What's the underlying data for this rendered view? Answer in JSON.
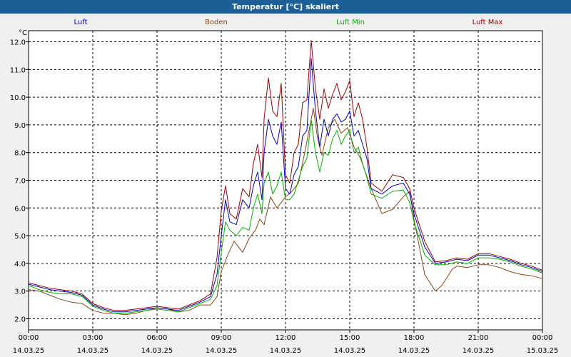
{
  "window": {
    "title": "Temperatur [°C] skaliert"
  },
  "chart_data": {
    "type": "line",
    "title": "Temperatur [°C] skaliert",
    "ylabel": "°C",
    "ylim": [
      1.6,
      12.4
    ],
    "yticks": [
      "2.0",
      "3.0",
      "4.0",
      "5.0",
      "6.0",
      "7.0",
      "8.0",
      "9.0",
      "10.0",
      "11.0",
      "12.0"
    ],
    "xlim": [
      0,
      24
    ],
    "xticks": [
      {
        "time": "00:00",
        "date": "14.03.25"
      },
      {
        "time": "03:00",
        "date": "14.03.25"
      },
      {
        "time": "06:00",
        "date": "14.03.25"
      },
      {
        "time": "09:00",
        "date": "14.03.25"
      },
      {
        "time": "12:00",
        "date": "14.03.25"
      },
      {
        "time": "15:00",
        "date": "14.03.25"
      },
      {
        "time": "18:00",
        "date": "14.03.25"
      },
      {
        "time": "21:00",
        "date": "14.03.25"
      },
      {
        "time": "00:00",
        "date": "15.03.25"
      }
    ],
    "grid": true,
    "legend_position": "top",
    "series": [
      {
        "name": "Luft",
        "color": "#0000c8",
        "points": [
          [
            0,
            3.25
          ],
          [
            0.5,
            3.15
          ],
          [
            1,
            3.05
          ],
          [
            1.5,
            3.0
          ],
          [
            2,
            2.95
          ],
          [
            2.5,
            2.85
          ],
          [
            3,
            2.5
          ],
          [
            3.5,
            2.35
          ],
          [
            4,
            2.25
          ],
          [
            4.5,
            2.25
          ],
          [
            5,
            2.3
          ],
          [
            5.5,
            2.35
          ],
          [
            6,
            2.4
          ],
          [
            6.5,
            2.35
          ],
          [
            7,
            2.3
          ],
          [
            7.5,
            2.45
          ],
          [
            8,
            2.6
          ],
          [
            8.5,
            2.8
          ],
          [
            8.8,
            3.6
          ],
          [
            9,
            5.0
          ],
          [
            9.2,
            6.3
          ],
          [
            9.4,
            5.5
          ],
          [
            9.7,
            5.4
          ],
          [
            10,
            6.3
          ],
          [
            10.3,
            6.0
          ],
          [
            10.5,
            6.8
          ],
          [
            10.7,
            7.3
          ],
          [
            10.9,
            6.3
          ],
          [
            11,
            8.0
          ],
          [
            11.2,
            9.2
          ],
          [
            11.4,
            8.6
          ],
          [
            11.6,
            8.3
          ],
          [
            11.8,
            9.1
          ],
          [
            12,
            6.7
          ],
          [
            12.2,
            6.5
          ],
          [
            12.4,
            7.2
          ],
          [
            12.6,
            7.5
          ],
          [
            12.8,
            8.6
          ],
          [
            13,
            8.8
          ],
          [
            13.2,
            11.4
          ],
          [
            13.4,
            9.5
          ],
          [
            13.6,
            8.2
          ],
          [
            13.8,
            9.2
          ],
          [
            14,
            8.6
          ],
          [
            14.2,
            9.2
          ],
          [
            14.4,
            9.4
          ],
          [
            14.6,
            9.1
          ],
          [
            14.8,
            9.2
          ],
          [
            15,
            9.5
          ],
          [
            15.2,
            8.6
          ],
          [
            15.4,
            8.8
          ],
          [
            15.6,
            8.3
          ],
          [
            15.8,
            7.8
          ],
          [
            16,
            6.7
          ],
          [
            16.5,
            6.5
          ],
          [
            17,
            6.8
          ],
          [
            17.5,
            6.9
          ],
          [
            17.8,
            6.5
          ],
          [
            18,
            5.8
          ],
          [
            18.5,
            4.6
          ],
          [
            19,
            4.0
          ],
          [
            19.5,
            4.05
          ],
          [
            20,
            4.15
          ],
          [
            20.5,
            4.1
          ],
          [
            21,
            4.3
          ],
          [
            21.5,
            4.3
          ],
          [
            22,
            4.2
          ],
          [
            22.5,
            4.1
          ],
          [
            23,
            3.95
          ],
          [
            23.5,
            3.85
          ],
          [
            24,
            3.7
          ]
        ]
      },
      {
        "name": "Boden",
        "color": "#8b4513",
        "points": [
          [
            0,
            3.05
          ],
          [
            0.5,
            3.0
          ],
          [
            1,
            2.85
          ],
          [
            1.5,
            2.7
          ],
          [
            2,
            2.6
          ],
          [
            2.5,
            2.55
          ],
          [
            3,
            2.3
          ],
          [
            3.5,
            2.2
          ],
          [
            4,
            2.2
          ],
          [
            4.5,
            2.15
          ],
          [
            5,
            2.2
          ],
          [
            5.5,
            2.3
          ],
          [
            6,
            2.4
          ],
          [
            6.5,
            2.35
          ],
          [
            7,
            2.25
          ],
          [
            7.5,
            2.3
          ],
          [
            8,
            2.5
          ],
          [
            8.5,
            2.5
          ],
          [
            8.8,
            2.8
          ],
          [
            9,
            3.7
          ],
          [
            9.3,
            4.3
          ],
          [
            9.6,
            4.8
          ],
          [
            10,
            4.4
          ],
          [
            10.3,
            4.9
          ],
          [
            10.6,
            5.2
          ],
          [
            10.8,
            5.6
          ],
          [
            11,
            5.4
          ],
          [
            11.3,
            6.4
          ],
          [
            11.6,
            6.0
          ],
          [
            12,
            6.4
          ],
          [
            12.3,
            6.6
          ],
          [
            12.6,
            6.9
          ],
          [
            12.9,
            8.0
          ],
          [
            13.1,
            8.8
          ],
          [
            13.3,
            9.6
          ],
          [
            13.5,
            8.5
          ],
          [
            13.7,
            7.9
          ],
          [
            14,
            8.9
          ],
          [
            14.3,
            9.2
          ],
          [
            14.6,
            8.7
          ],
          [
            14.9,
            8.9
          ],
          [
            15.2,
            8.2
          ],
          [
            15.5,
            7.8
          ],
          [
            16,
            6.7
          ],
          [
            16.5,
            5.8
          ],
          [
            17,
            5.95
          ],
          [
            17.5,
            6.4
          ],
          [
            17.8,
            6.6
          ],
          [
            18,
            5.6
          ],
          [
            18.5,
            3.6
          ],
          [
            19,
            3.0
          ],
          [
            19.3,
            3.2
          ],
          [
            19.8,
            3.8
          ],
          [
            20,
            3.9
          ],
          [
            20.5,
            3.85
          ],
          [
            21,
            3.95
          ],
          [
            21.5,
            3.95
          ],
          [
            22,
            3.85
          ],
          [
            22.5,
            3.7
          ],
          [
            23,
            3.6
          ],
          [
            23.5,
            3.55
          ],
          [
            24,
            3.45
          ]
        ]
      },
      {
        "name": "Luft Min",
        "color": "#00b400",
        "points": [
          [
            0,
            3.2
          ],
          [
            0.5,
            3.05
          ],
          [
            1,
            2.95
          ],
          [
            1.5,
            2.9
          ],
          [
            2,
            2.9
          ],
          [
            2.5,
            2.8
          ],
          [
            3,
            2.45
          ],
          [
            3.5,
            2.3
          ],
          [
            4,
            2.2
          ],
          [
            4.5,
            2.2
          ],
          [
            5,
            2.25
          ],
          [
            5.5,
            2.3
          ],
          [
            6,
            2.35
          ],
          [
            6.5,
            2.3
          ],
          [
            7,
            2.25
          ],
          [
            7.5,
            2.4
          ],
          [
            8,
            2.55
          ],
          [
            8.5,
            2.7
          ],
          [
            8.8,
            3.2
          ],
          [
            9,
            4.4
          ],
          [
            9.2,
            5.5
          ],
          [
            9.4,
            5.2
          ],
          [
            9.7,
            5.0
          ],
          [
            10,
            5.3
          ],
          [
            10.3,
            5.2
          ],
          [
            10.5,
            6.0
          ],
          [
            10.7,
            6.5
          ],
          [
            10.9,
            5.8
          ],
          [
            11,
            6.9
          ],
          [
            11.2,
            7.3
          ],
          [
            11.4,
            6.5
          ],
          [
            11.6,
            6.8
          ],
          [
            11.8,
            7.3
          ],
          [
            12,
            6.3
          ],
          [
            12.2,
            6.3
          ],
          [
            12.4,
            6.5
          ],
          [
            12.6,
            7.0
          ],
          [
            12.8,
            7.5
          ],
          [
            13,
            7.8
          ],
          [
            13.2,
            9.2
          ],
          [
            13.4,
            8.0
          ],
          [
            13.6,
            7.3
          ],
          [
            13.8,
            8.0
          ],
          [
            14,
            7.9
          ],
          [
            14.2,
            8.5
          ],
          [
            14.4,
            8.8
          ],
          [
            14.6,
            8.3
          ],
          [
            14.8,
            8.6
          ],
          [
            15,
            8.8
          ],
          [
            15.2,
            8.0
          ],
          [
            15.4,
            8.2
          ],
          [
            15.6,
            7.6
          ],
          [
            15.8,
            7.1
          ],
          [
            16,
            6.5
          ],
          [
            16.5,
            6.35
          ],
          [
            17,
            6.6
          ],
          [
            17.5,
            6.65
          ],
          [
            17.8,
            6.2
          ],
          [
            18,
            5.5
          ],
          [
            18.5,
            4.3
          ],
          [
            19,
            3.95
          ],
          [
            19.5,
            3.95
          ],
          [
            20,
            4.05
          ],
          [
            20.5,
            4.0
          ],
          [
            21,
            4.2
          ],
          [
            21.5,
            4.2
          ],
          [
            22,
            4.15
          ],
          [
            22.5,
            4.05
          ],
          [
            23,
            3.9
          ],
          [
            23.5,
            3.8
          ],
          [
            24,
            3.65
          ]
        ]
      },
      {
        "name": "Luft Max",
        "color": "#a00000",
        "points": [
          [
            0,
            3.3
          ],
          [
            0.5,
            3.2
          ],
          [
            1,
            3.1
          ],
          [
            1.5,
            3.05
          ],
          [
            2,
            3.0
          ],
          [
            2.5,
            2.9
          ],
          [
            3,
            2.55
          ],
          [
            3.5,
            2.4
          ],
          [
            4,
            2.3
          ],
          [
            4.5,
            2.3
          ],
          [
            5,
            2.35
          ],
          [
            5.5,
            2.4
          ],
          [
            6,
            2.45
          ],
          [
            6.5,
            2.4
          ],
          [
            7,
            2.35
          ],
          [
            7.5,
            2.5
          ],
          [
            8,
            2.65
          ],
          [
            8.5,
            2.9
          ],
          [
            8.8,
            4.2
          ],
          [
            9,
            5.9
          ],
          [
            9.2,
            6.8
          ],
          [
            9.4,
            5.8
          ],
          [
            9.7,
            5.6
          ],
          [
            10,
            6.7
          ],
          [
            10.3,
            6.4
          ],
          [
            10.5,
            7.6
          ],
          [
            10.7,
            8.3
          ],
          [
            10.9,
            7.1
          ],
          [
            11,
            9.2
          ],
          [
            11.2,
            10.7
          ],
          [
            11.4,
            9.5
          ],
          [
            11.6,
            9.3
          ],
          [
            11.8,
            10.5
          ],
          [
            12,
            7.2
          ],
          [
            12.2,
            6.9
          ],
          [
            12.4,
            8.0
          ],
          [
            12.6,
            8.3
          ],
          [
            12.8,
            9.8
          ],
          [
            13,
            9.9
          ],
          [
            13.2,
            12.05
          ],
          [
            13.4,
            10.3
          ],
          [
            13.6,
            9.2
          ],
          [
            13.8,
            10.3
          ],
          [
            14,
            9.6
          ],
          [
            14.2,
            10.1
          ],
          [
            14.4,
            10.5
          ],
          [
            14.6,
            9.9
          ],
          [
            14.8,
            10.2
          ],
          [
            15,
            10.6
          ],
          [
            15.2,
            9.3
          ],
          [
            15.4,
            9.8
          ],
          [
            15.6,
            9.2
          ],
          [
            15.8,
            8.2
          ],
          [
            16,
            6.9
          ],
          [
            16.5,
            6.6
          ],
          [
            17,
            7.2
          ],
          [
            17.5,
            7.1
          ],
          [
            17.8,
            6.7
          ],
          [
            18,
            6.0
          ],
          [
            18.5,
            4.8
          ],
          [
            19,
            4.05
          ],
          [
            19.5,
            4.1
          ],
          [
            20,
            4.2
          ],
          [
            20.5,
            4.15
          ],
          [
            21,
            4.35
          ],
          [
            21.5,
            4.35
          ],
          [
            22,
            4.25
          ],
          [
            22.5,
            4.15
          ],
          [
            23,
            4.0
          ],
          [
            23.5,
            3.9
          ],
          [
            24,
            3.75
          ]
        ]
      }
    ]
  }
}
